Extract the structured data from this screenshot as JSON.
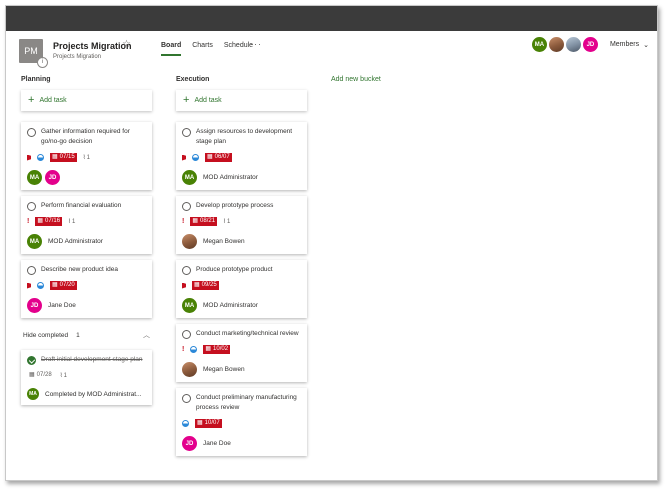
{
  "plan": {
    "icon_text": "PM",
    "badge": "i",
    "title": "Projects Migration",
    "subtitle": "Projects Migration",
    "star_icon": "star-outline-icon"
  },
  "tabs": [
    {
      "label": "Board",
      "active": true
    },
    {
      "label": "Charts",
      "active": false
    },
    {
      "label": "Schedule",
      "active": false
    }
  ],
  "more": "···",
  "members": {
    "avatars": [
      "MA",
      "",
      "",
      "JD"
    ],
    "label": "Members",
    "chevron": "⌄"
  },
  "new_bucket": "Add new bucket",
  "add_task_label": "Add task",
  "buckets": {
    "planning": {
      "title": "Planning",
      "tasks": [
        {
          "title": "Gather information required for go/no-go decision",
          "due": "07/15",
          "attachments": "1",
          "assignees": [
            "MA",
            "JD"
          ]
        },
        {
          "title": "Perform financial evaluation",
          "priority": "!",
          "due": "07/16",
          "attachments": "1",
          "assignee_initials": "MA",
          "assignee_name": "MOD Administrator"
        },
        {
          "title": "Describe new product idea",
          "due": "07/20",
          "assignee_initials": "JD",
          "assignee_name": "Jane Doe"
        }
      ],
      "hide_completed": {
        "label": "Hide completed",
        "count": "1",
        "chevron": "^"
      },
      "completed": [
        {
          "title": "Draft initial development stage plan",
          "due": "07/28",
          "attachments": "1",
          "assignee_initials": "MA",
          "completed_by": "Completed by MOD Administrat..."
        }
      ]
    },
    "execution": {
      "title": "Execution",
      "tasks": [
        {
          "title": "Assign resources to development stage plan",
          "due": "06/07",
          "assignee_initials": "MA",
          "assignee_name": "MOD Administrator"
        },
        {
          "title": "Develop prototype process",
          "priority": "!",
          "due": "08/21",
          "attachments": "1",
          "assignee_name": "Megan Bowen"
        },
        {
          "title": "Produce prototype product",
          "due": "09/25",
          "assignee_initials": "MA",
          "assignee_name": "MOD Administrator"
        },
        {
          "title": "Conduct marketing/technical review",
          "priority": "!",
          "due": "10/02",
          "assignee_name": "Megan Bowen"
        },
        {
          "title": "Conduct preliminary manufacturing process review",
          "due": "10/07",
          "assignee_initials": "JD",
          "assignee_name": "Jane Doe"
        }
      ]
    }
  },
  "colors": {
    "accent_green": "#31752f",
    "overdue_red": "#c50f1f",
    "avatar_ma": "#498205",
    "avatar_jd": "#e3008c"
  }
}
